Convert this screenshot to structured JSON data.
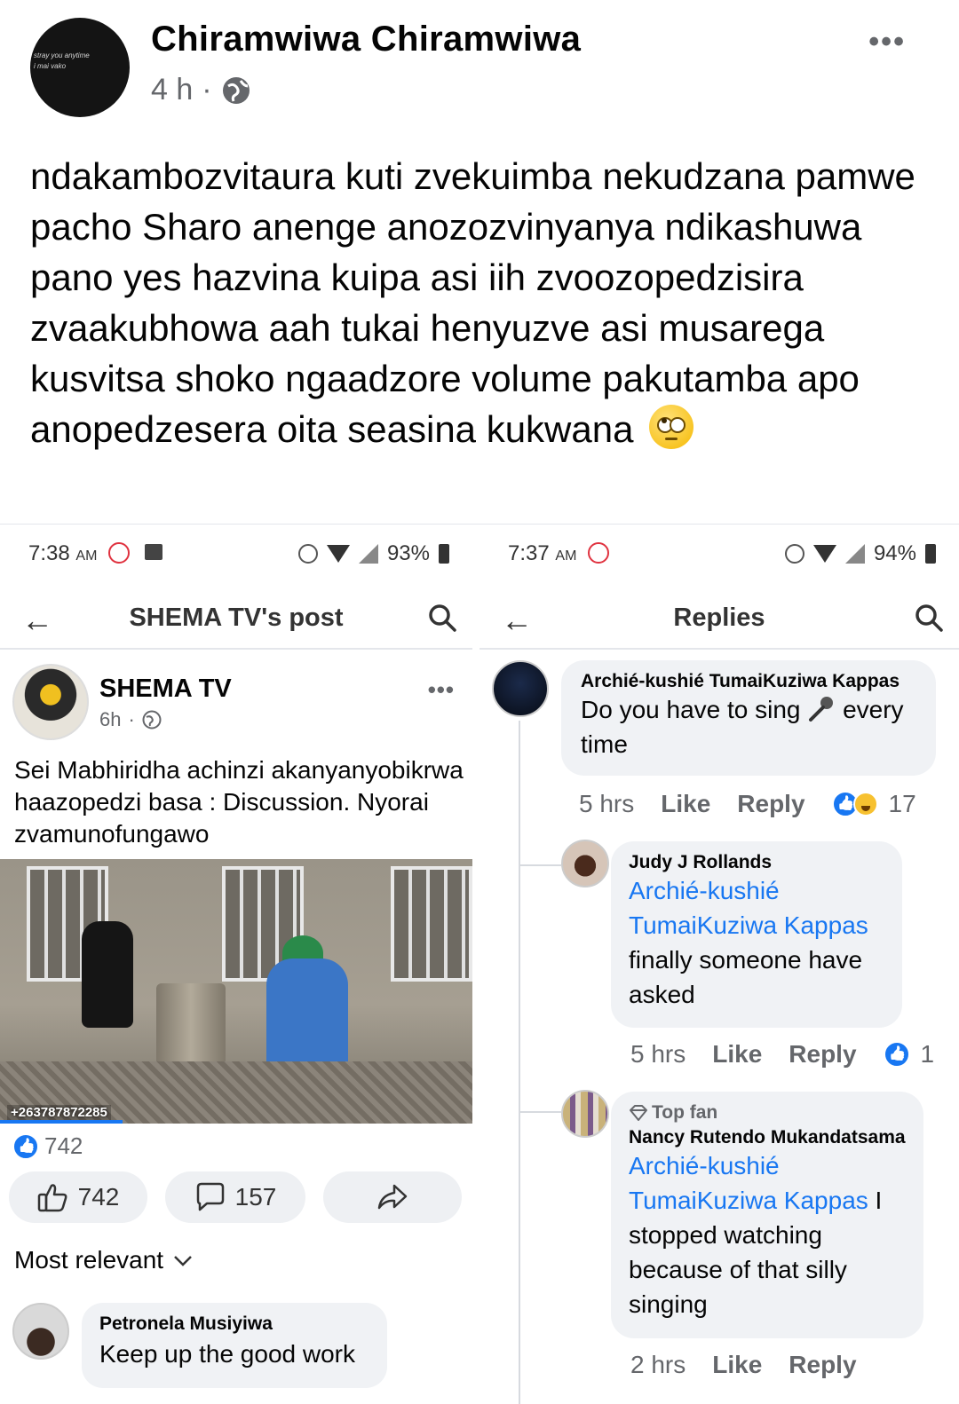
{
  "post": {
    "author": "Chiramwiwa Chiramwiwa",
    "time": "4 h",
    "meta_sep": "·",
    "avatar_text_1": "stray you anytime",
    "avatar_text_2": "i mai vako",
    "text": "ndakambozvitaura kuti zvekuimba nekudzana pamwe pacho Sharo anenge anozozvinyanya ndikashuwa pano yes hazvina kuipa asi iih zvoozopedzisira zvaakubhowa aah tukai henyuzve asi musarega kusvitsa shoko ngaadzore volume pakutamba apo anopedzesera  oita seasina kukwana",
    "more_label": "•••"
  },
  "left_screen": {
    "status": {
      "time": "7:38",
      "ampm": "AM",
      "battery": "93%"
    },
    "appbar": {
      "title": "SHEMA TV's post"
    },
    "shema": {
      "name": "SHEMA TV",
      "time": "6h",
      "meta_sep": "·",
      "text": "Sei Mabhiridha achinzi akanyanyobikrwa haazopedzi basa : Discussion. Nyorai zvamunofungawo",
      "phone_watermark": "+263787872285",
      "reaction_count": "742",
      "like_count": "742",
      "comment_count": "157",
      "more_label": "•••",
      "video_progress": 0.26
    },
    "sort_label": "Most relevant",
    "comment": {
      "name": "Petronela Musiyiwa",
      "text": "Keep up the good work"
    }
  },
  "right_screen": {
    "status": {
      "time": "7:37",
      "ampm": "AM",
      "battery": "94%"
    },
    "appbar": {
      "title": "Replies"
    },
    "comment1": {
      "name": "Archié-kushié TumaiKuziwa Kappas",
      "text_before": "Do you have to sing",
      "text_after": "every time",
      "time": "5 hrs",
      "like": "Like",
      "reply": "Reply",
      "reactions": "17"
    },
    "comment2": {
      "name": "Judy J Rollands",
      "mention": "Archié-kushié TumaiKuziwa Kappas",
      "text": "finally someone have asked",
      "time": "5 hrs",
      "like": "Like",
      "reply": "Reply",
      "reactions": "1"
    },
    "comment3": {
      "badge": "Top fan",
      "name": "Nancy Rutendo Mukandatsama",
      "mention": "Archié-kushié TumaiKuziwa Kappas",
      "text": "I stopped watching because of that silly singing",
      "time": "2 hrs",
      "like": "Like",
      "reply": "Reply"
    }
  },
  "colors": {
    "link": "#1877f2",
    "meta": "#65676b",
    "bubble": "#f0f2f5",
    "pill": "#eef0f3"
  }
}
